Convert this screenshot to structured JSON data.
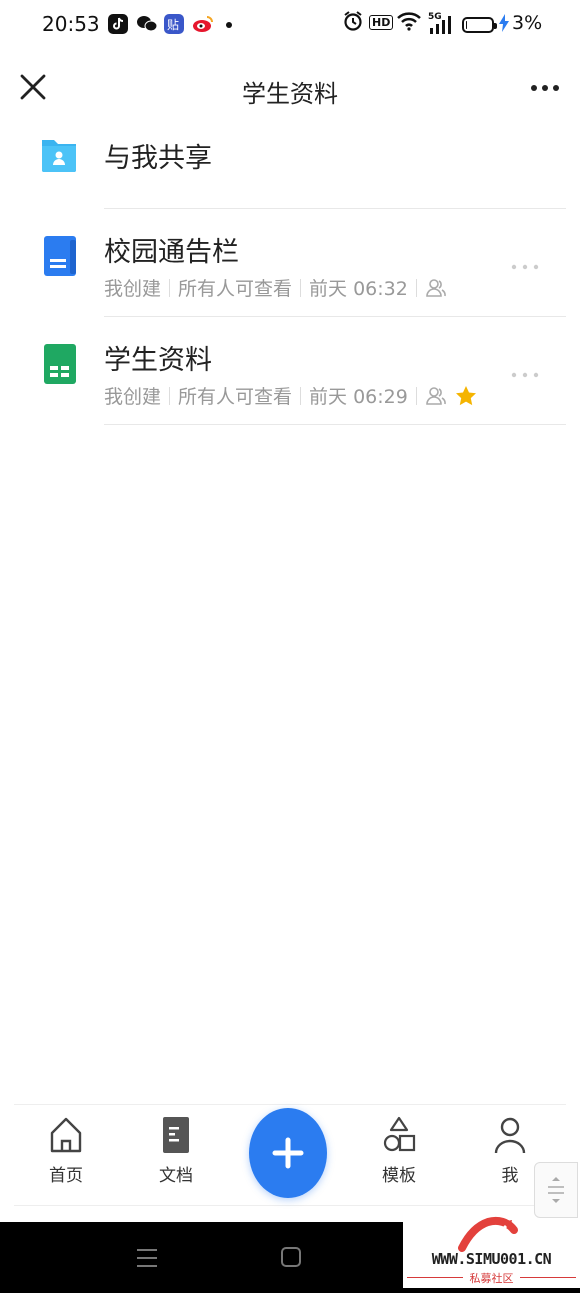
{
  "status_bar": {
    "time": "20:53",
    "app_icons": [
      "douyin-icon",
      "wechat-icon",
      "tieba-icon",
      "weibo-icon"
    ],
    "network": "5G",
    "hd_label": "HD",
    "battery_level": 0.03,
    "battery_text": "3%"
  },
  "header": {
    "title": "学生资料",
    "close_icon": "close-icon",
    "more_icon": "more-horizontal-icon"
  },
  "items": [
    {
      "title": "与我共享",
      "icon": "shared-folder-icon",
      "icon_color": "#3bb4f0"
    },
    {
      "title": "校园通告栏",
      "icon": "doc-icon",
      "icon_color": "#2b7cf0",
      "creator": "我创建",
      "visibility": "所有人可查看",
      "time": "前天 06:32",
      "starred": false
    },
    {
      "title": "学生资料",
      "icon": "sheet-icon",
      "icon_color": "#1fa862",
      "creator": "我创建",
      "visibility": "所有人可查看",
      "time": "前天 06:29",
      "starred": true,
      "star_color": "#f5b400"
    }
  ],
  "tab_bar": {
    "tabs": [
      {
        "label": "首页",
        "icon": "home-icon"
      },
      {
        "label": "文档",
        "icon": "document-icon"
      },
      {
        "label": "模板",
        "icon": "template-icon"
      },
      {
        "label": "我",
        "icon": "person-icon"
      }
    ],
    "fab_icon": "plus-icon",
    "fab_color": "#2b7cf0"
  },
  "watermark": {
    "url": "WWW.SIMU001.CN",
    "sub": "私募社区"
  }
}
